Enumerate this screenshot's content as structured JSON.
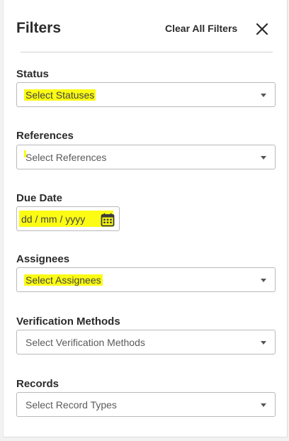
{
  "header": {
    "title": "Filters",
    "clear_all_label": "Clear All Filters",
    "close_icon": "close-icon"
  },
  "filters": {
    "status": {
      "label": "Status",
      "placeholder": "Select Statuses",
      "highlighted": true
    },
    "references": {
      "label": "References",
      "placeholder": "Select References",
      "highlight_mark": true
    },
    "due_date": {
      "label": "Due Date",
      "placeholder": "dd / mm / yyyy",
      "icon": "calendar-icon",
      "highlighted": true
    },
    "assignees": {
      "label": "Assignees",
      "placeholder": "Select Assignees",
      "highlighted": true
    },
    "verification_methods": {
      "label": "Verification Methods",
      "placeholder": "Select Verification Methods"
    },
    "records": {
      "label": "Records",
      "placeholder": "Select Record Types"
    }
  },
  "colors": {
    "highlight": "#fbfb14",
    "text": "#2b2b2b",
    "placeholder": "#5b5b5b",
    "border": "#b9b9b9"
  }
}
